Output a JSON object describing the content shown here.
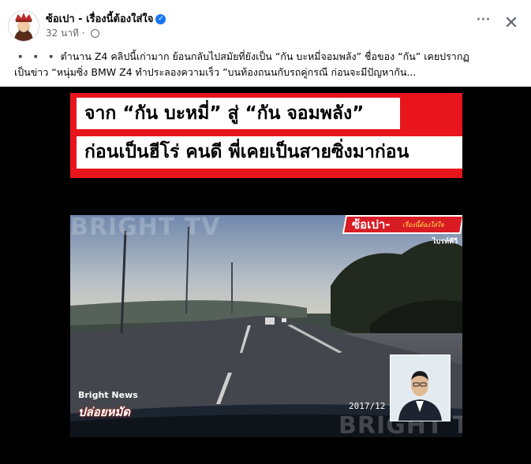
{
  "post": {
    "page_name": "ซ้อเปา - เรื่องนี้ต้องใส่ใจ",
    "timestamp": "32 นาที",
    "caption_line1": "▪️ ▪️ ▪️ ตำนาน Z4 คลิปนี้เก่ามาก ย้อนกลับไปสมัยที่ยังเป็น “กัน บะหมี่จอมพลัง” ชื่อของ “กัน” เคยปรากฏ",
    "caption_line2": "เป็นข่าว “หนุ่มซิ่ง BMW Z4 ทำประลองความเร็ว ”บนท้องถนนกับรถคู่กรณี ก่อนจะมีปัญหากัน..."
  },
  "icons": {
    "more": "more-horizontal-icon",
    "close": "close-icon",
    "verified": "verified-badge-icon",
    "privacy": "globe-icon"
  },
  "video": {
    "headline1": "จาก “กัน บะหมี่” สู่ “กัน จอมพลัง”",
    "headline2": "ก่อนเป็นฮีโร่ คนดี พี่เคยเป็นสายซิ่งมาก่อน",
    "watermark": "BRIGHT TV",
    "logo_main": "ซ้อเปา-",
    "logo_sub": "เรื่องนี้ต้องใส่ใจ",
    "logo_channel": "ไบรท์ทีวี",
    "news_brand": "Bright News",
    "news_show": "ปล่อยหมัด",
    "timestamp": "2017/12"
  },
  "colors": {
    "accent_red": "#e8151d",
    "verified_blue": "#1877f2"
  }
}
